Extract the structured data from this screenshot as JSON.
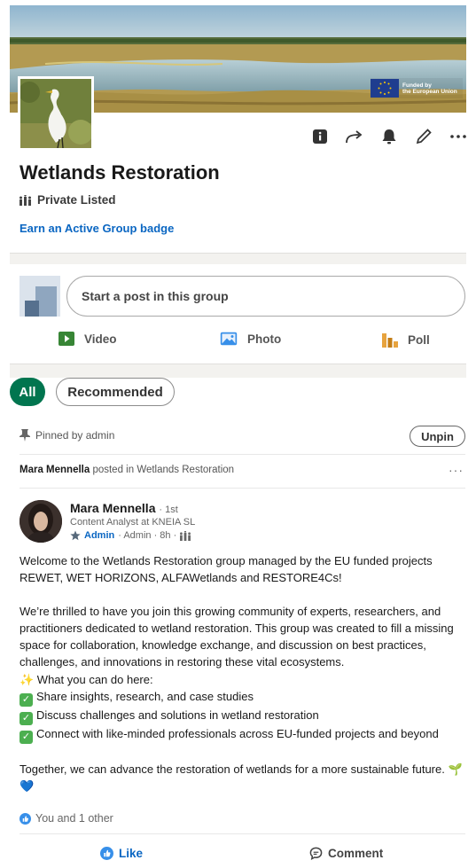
{
  "group": {
    "name": "Wetlands Restoration",
    "privacy": "Private Listed",
    "badge_link": "Earn an Active Group badge",
    "cover_badge": {
      "line1": "Funded by",
      "line2": "the European Union"
    }
  },
  "actions": [
    "info-icon",
    "share-icon",
    "bell-icon",
    "edit-pencil-icon",
    "more-icon"
  ],
  "composer": {
    "placeholder": "Start a post in this group",
    "video_label": "Video",
    "photo_label": "Photo",
    "poll_label": "Poll"
  },
  "filters": {
    "all": "All",
    "recommended": "Recommended"
  },
  "pinned": {
    "label": "Pinned by admin",
    "unpin": "Unpin"
  },
  "post": {
    "context_author": "Mara Mennella",
    "context_rest": " posted in Wetlands Restoration",
    "more": "···",
    "author": {
      "name": "Mara Mennella",
      "degree": "· 1st",
      "headline": "Content Analyst at KNEIA SL",
      "role": "Admin",
      "meta": "· Admin · 8h ·"
    },
    "body": {
      "p1": "Welcome to the Wetlands Restoration group managed by the EU funded projects REWET, WET HORIZONS, ALFAWetlands and RESTORE4Cs!",
      "p2": "We’re thrilled to have you join this growing community of experts, researchers, and practitioners dedicated to wetland restoration. This group was created to fill a missing space for collaboration, knowledge exchange, and discussion on best practices, challenges, and innovations in restoring these vital ecosystems.",
      "intro": "✨ What you can do here:",
      "item1": "Share insights, research, and case studies",
      "item2": "Discuss challenges and solutions in wetland restoration",
      "item3": "Connect with like-minded professionals across EU-funded projects and beyond",
      "closing": "Together, we can advance the restoration of wetlands for a more sustainable future. 🌱💙"
    },
    "reactions": "You and 1 other",
    "like_label": "Like",
    "comment_label": "Comment"
  },
  "colors": {
    "link": "#0a66c2",
    "chip_active": "#01754f",
    "check": "#4caf50",
    "poll": "#e7a33e",
    "video": "#378535",
    "photo": "#378fe9"
  }
}
